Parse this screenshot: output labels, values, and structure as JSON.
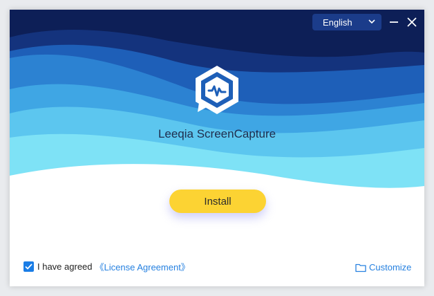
{
  "app": {
    "title": "Leeqia ScreenCapture"
  },
  "language": {
    "selected": "English",
    "icon": "chevron-down-icon"
  },
  "window_controls": {
    "minimize_icon": "minimize-icon",
    "close_icon": "close-icon"
  },
  "install": {
    "label": "Install"
  },
  "agreement": {
    "checked": true,
    "text": "I have agreed",
    "link_label": "《License Agreement》"
  },
  "customize": {
    "label": "Customize",
    "icon": "folder-icon"
  },
  "colors": {
    "wave_dark": "#0d1f57",
    "wave_mid": "#1e5fb8",
    "wave_light": "#3fa6e4",
    "wave_cyan": "#7ee2f6",
    "accent_yellow": "#fcd333",
    "link_blue": "#2580e0"
  }
}
